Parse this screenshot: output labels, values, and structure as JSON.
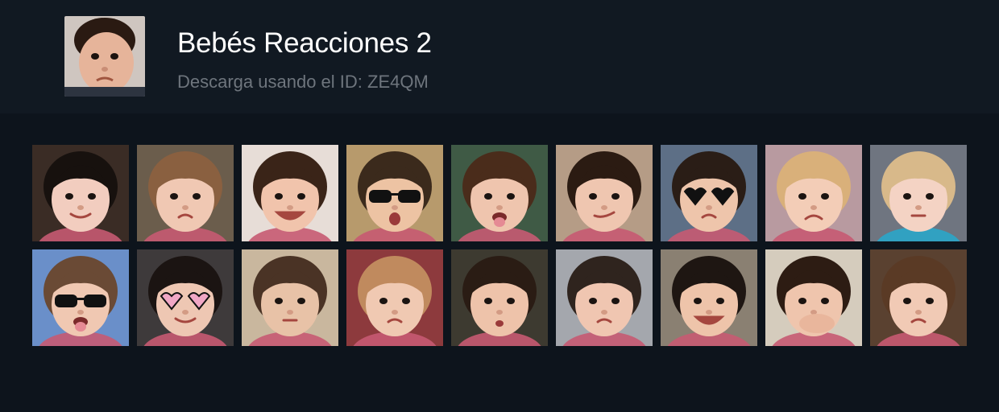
{
  "header": {
    "title": "Bebés Reacciones 2",
    "subtitle": "Descarga usando el ID: ZE4QM",
    "cover_icon": "baby-face-icon"
  },
  "stickers": [
    {
      "name": "baby-dark-hair-blue-eyes",
      "bg": "#3a2c25",
      "skin": "#f2cdbf",
      "hair": "#17110e",
      "accessory": "none",
      "mouth": "smile"
    },
    {
      "name": "baby-curly-hair-side-glance",
      "bg": "#6b5d4c",
      "skin": "#f0c8b3",
      "hair": "#8a6040",
      "accessory": "none",
      "mouth": "pout"
    },
    {
      "name": "baby-chubby-smile",
      "bg": "#e7ddd7",
      "skin": "#f1c4ac",
      "hair": "#3a2418",
      "accessory": "none",
      "mouth": "grin"
    },
    {
      "name": "baby-sunglasses-beach",
      "bg": "#b79a6c",
      "skin": "#edc3a3",
      "hair": "#3b2a1c",
      "accessory": "sunglasses",
      "mouth": "open"
    },
    {
      "name": "baby-curly-tongue-out",
      "bg": "#3f5a45",
      "skin": "#efc5ae",
      "hair": "#4a2c1b",
      "accessory": "none",
      "mouth": "tongue"
    },
    {
      "name": "baby-skeptical-face",
      "bg": "#b59c86",
      "skin": "#efc6b0",
      "hair": "#2b1b12",
      "accessory": "none",
      "mouth": "smirk"
    },
    {
      "name": "baby-heart-sunglasses",
      "bg": "#5d6f86",
      "skin": "#eec5ab",
      "hair": "#2a1d16",
      "accessory": "heart-glasses",
      "mouth": "pout"
    },
    {
      "name": "baby-hands-on-head",
      "bg": "#b89aa0",
      "skin": "#f3cdb7",
      "hair": "#d9b07a",
      "accessory": "none",
      "mouth": "frown"
    },
    {
      "name": "baby-blonde-thinking",
      "bg": "#6f7580",
      "skin": "#f4d3c4",
      "hair": "#d8b98a",
      "accessory": "none",
      "mouth": "neutral"
    },
    {
      "name": "baby-big-sunglasses-tongue",
      "bg": "#6a8fc9",
      "skin": "#f0c8b2",
      "hair": "#6a4a35",
      "accessory": "sunglasses",
      "mouth": "tongue"
    },
    {
      "name": "baby-pink-heart-glasses-thumbs",
      "bg": "#3e3a3b",
      "skin": "#eec7b3",
      "hair": "#1b1412",
      "accessory": "heart-glasses",
      "mouth": "smile"
    },
    {
      "name": "baby-mirror-selfie",
      "bg": "#c9b79e",
      "skin": "#e8c2a7",
      "hair": "#4a3325",
      "accessory": "none",
      "mouth": "neutral"
    },
    {
      "name": "baby-pink-hoodie",
      "bg": "#8d3a3d",
      "skin": "#f0c9b2",
      "hair": "#c08a5e",
      "accessory": "none",
      "mouth": "pout"
    },
    {
      "name": "baby-kissy-face",
      "bg": "#3d3a30",
      "skin": "#eec3aa",
      "hair": "#2a1c14",
      "accessory": "none",
      "mouth": "kiss"
    },
    {
      "name": "baby-wide-eyes-close-up",
      "bg": "#a4a7ad",
      "skin": "#f0c6b1",
      "hair": "#2f241e",
      "accessory": "none",
      "mouth": "pout"
    },
    {
      "name": "baby-thumbs-up-laugh",
      "bg": "#8a8072",
      "skin": "#eec4aa",
      "hair": "#1e1612",
      "accessory": "none",
      "mouth": "grin"
    },
    {
      "name": "baby-hand-over-mouth",
      "bg": "#d5ccbd",
      "skin": "#efc5ad",
      "hair": "#2d1c13",
      "accessory": "none",
      "mouth": "covered"
    },
    {
      "name": "baby-hands-on-cheeks",
      "bg": "#5a4130",
      "skin": "#f1cab5",
      "hair": "#5a3a25",
      "accessory": "none",
      "mouth": "pout"
    }
  ],
  "colors": {
    "page_bg": "#0d141c",
    "header_bg": "#111922",
    "title": "#ffffff",
    "subtitle": "#6e757d"
  }
}
